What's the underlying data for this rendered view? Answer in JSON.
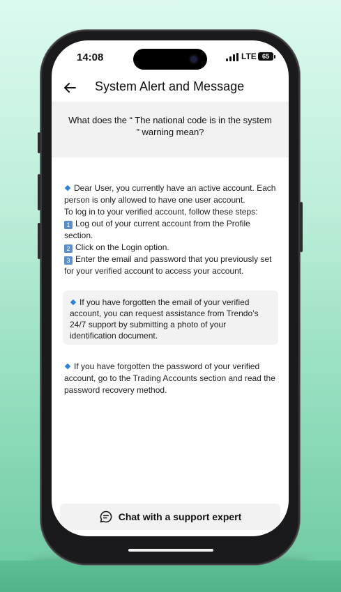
{
  "status_bar": {
    "time": "14:08",
    "network": "LTE",
    "battery": "65"
  },
  "header": {
    "title": "System Alert and Message",
    "back_icon": "arrow-left-icon"
  },
  "question": {
    "line1": "What does the “ The national code is in the system",
    "line2": "” warning mean?"
  },
  "content": {
    "para1": {
      "line1": "Dear User, you currently have an active account. Each",
      "line2": "person is only allowed to have one user account.",
      "line3": "To log in to your verified account, follow these steps:"
    },
    "steps": [
      {
        "num": "1",
        "line1": "Log out of your current account from the Profile",
        "line2": "section."
      },
      {
        "num": "2",
        "line1": "Click on the Login option."
      },
      {
        "num": "3",
        "line1": "Enter the email and password that you previously set",
        "line2": "for your verified account to access your account."
      }
    ],
    "note": {
      "line1": "If you have forgotten the email of your verified",
      "line2": "account, you can request assistance from Trendo’s",
      "line3": "24/7 support by submitting a photo of your",
      "line4": "identification document."
    },
    "para3": {
      "line1": "If you have forgotten the password of your verified",
      "line2": "account, go to the Trading Accounts section and read the",
      "line3": "password recovery method."
    }
  },
  "footer": {
    "chat_button_label": "Chat with a support expert",
    "chat_icon": "chat-bubble-icon"
  },
  "colors": {
    "diamond": "#2f7fd6",
    "panel_bg": "#f2f2f2"
  }
}
